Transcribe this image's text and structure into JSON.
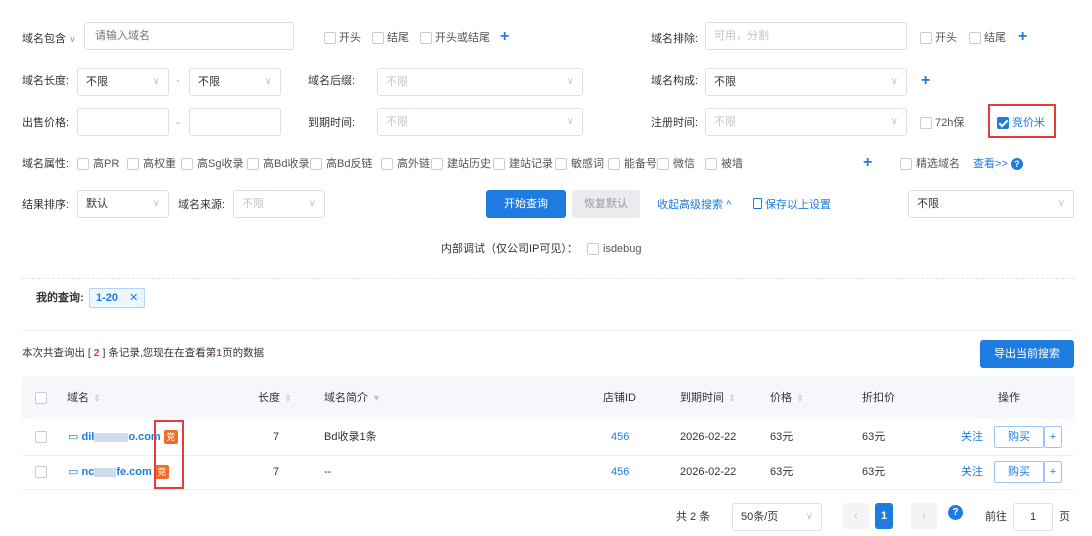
{
  "filters": {
    "domain_contains": {
      "label": "域名包含",
      "placeholder": "请输入域名"
    },
    "contains_opts": [
      "开头",
      "结尾",
      "开头或结尾"
    ],
    "domain_exclude": {
      "label": "域名排除:",
      "placeholder": "可用，分割"
    },
    "exclude_opts": [
      "开头",
      "结尾"
    ],
    "length": {
      "label": "域名长度:",
      "from": "不限",
      "dash": "-",
      "to": "不限"
    },
    "suffix": {
      "label": "域名后缀:",
      "placeholder": "不限"
    },
    "composition": {
      "label": "域名构成:",
      "value": "不限"
    },
    "price": {
      "label": "出售价格:",
      "dash": "-"
    },
    "expire": {
      "label": "到期时间:",
      "placeholder": "不限"
    },
    "register": {
      "label": "注册时间:",
      "placeholder": "不限"
    },
    "opt_72h": "72h保",
    "opt_auction": "竞价米",
    "attrs_label": "域名属性:",
    "attrs": [
      "高PR",
      "高权重",
      "高Sg收录",
      "高Bd收录",
      "高Bd反链",
      "高外链",
      "建站历史",
      "建站记录",
      "敏感词",
      "能备号",
      "微信",
      "被墙"
    ],
    "featured": "精选域名",
    "view_more": "查看>>",
    "sort": {
      "label": "结果排序:",
      "value": "默认"
    },
    "source": {
      "label": "域名来源:",
      "placeholder": "不限"
    },
    "right_select": "不限",
    "btn_search": "开始查询",
    "btn_reset": "恢复默认",
    "collapse": "收起高级搜索",
    "save": "保存以上设置",
    "debug_label": "内部调试（仅公司IP可见）：",
    "debug_opt": "isdebug"
  },
  "my_query": {
    "label": "我的查询:",
    "tag": "1-20"
  },
  "summary": {
    "pre": "本次共查询出 [ ",
    "count": "2",
    "mid": " ] 条记录,您现在在查看第",
    "page": "1",
    "post": "页的数据"
  },
  "export_btn": "导出当前搜索",
  "table": {
    "headers": {
      "domain": "域名",
      "length": "长度",
      "intro": "域名简介",
      "shop": "店铺ID",
      "expire": "到期时间",
      "price": "价格",
      "discount": "折扣价",
      "ops": "操作"
    },
    "rows": [
      {
        "domain_a": "dil",
        "domain_b": "o.com",
        "tag": "竞",
        "length": "7",
        "intro": "Bd收录1条",
        "shop": "456",
        "expire": "2026-02-22",
        "price": "63元",
        "discount": "63元",
        "follow": "关注",
        "buy": "购买",
        "add": "+"
      },
      {
        "domain_a": "nc",
        "domain_b": "fe.com",
        "tag": "竞",
        "length": "7",
        "intro": "--",
        "shop": "456",
        "expire": "2026-02-22",
        "price": "63元",
        "discount": "63元",
        "follow": "关注",
        "buy": "购买",
        "add": "+"
      }
    ]
  },
  "pagination": {
    "total": "共 2 条",
    "per_page": "50条/页",
    "current": "1",
    "goto": "前往",
    "page_input": "1",
    "page_unit": "页"
  },
  "colors": {
    "accent": "#1e7ce0",
    "highlight": "#e83a3a",
    "tag": "#f26b2a"
  }
}
